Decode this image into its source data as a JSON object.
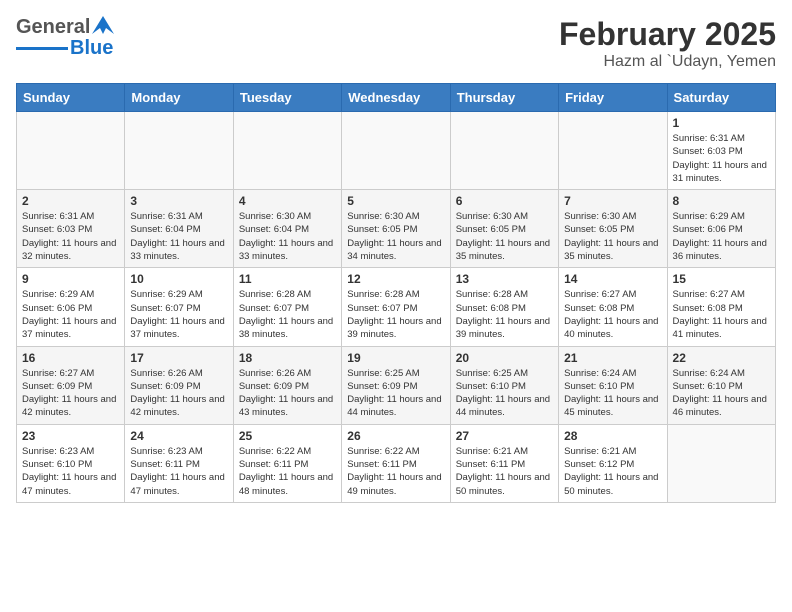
{
  "header": {
    "logo_general": "General",
    "logo_blue": "Blue",
    "title": "February 2025",
    "subtitle": "Hazm al `Udayn, Yemen"
  },
  "calendar": {
    "headers": [
      "Sunday",
      "Monday",
      "Tuesday",
      "Wednesday",
      "Thursday",
      "Friday",
      "Saturday"
    ],
    "weeks": [
      [
        {
          "day": "",
          "info": ""
        },
        {
          "day": "",
          "info": ""
        },
        {
          "day": "",
          "info": ""
        },
        {
          "day": "",
          "info": ""
        },
        {
          "day": "",
          "info": ""
        },
        {
          "day": "",
          "info": ""
        },
        {
          "day": "1",
          "info": "Sunrise: 6:31 AM\nSunset: 6:03 PM\nDaylight: 11 hours and 31 minutes."
        }
      ],
      [
        {
          "day": "2",
          "info": "Sunrise: 6:31 AM\nSunset: 6:03 PM\nDaylight: 11 hours and 32 minutes."
        },
        {
          "day": "3",
          "info": "Sunrise: 6:31 AM\nSunset: 6:04 PM\nDaylight: 11 hours and 33 minutes."
        },
        {
          "day": "4",
          "info": "Sunrise: 6:30 AM\nSunset: 6:04 PM\nDaylight: 11 hours and 33 minutes."
        },
        {
          "day": "5",
          "info": "Sunrise: 6:30 AM\nSunset: 6:05 PM\nDaylight: 11 hours and 34 minutes."
        },
        {
          "day": "6",
          "info": "Sunrise: 6:30 AM\nSunset: 6:05 PM\nDaylight: 11 hours and 35 minutes."
        },
        {
          "day": "7",
          "info": "Sunrise: 6:30 AM\nSunset: 6:05 PM\nDaylight: 11 hours and 35 minutes."
        },
        {
          "day": "8",
          "info": "Sunrise: 6:29 AM\nSunset: 6:06 PM\nDaylight: 11 hours and 36 minutes."
        }
      ],
      [
        {
          "day": "9",
          "info": "Sunrise: 6:29 AM\nSunset: 6:06 PM\nDaylight: 11 hours and 37 minutes."
        },
        {
          "day": "10",
          "info": "Sunrise: 6:29 AM\nSunset: 6:07 PM\nDaylight: 11 hours and 37 minutes."
        },
        {
          "day": "11",
          "info": "Sunrise: 6:28 AM\nSunset: 6:07 PM\nDaylight: 11 hours and 38 minutes."
        },
        {
          "day": "12",
          "info": "Sunrise: 6:28 AM\nSunset: 6:07 PM\nDaylight: 11 hours and 39 minutes."
        },
        {
          "day": "13",
          "info": "Sunrise: 6:28 AM\nSunset: 6:08 PM\nDaylight: 11 hours and 39 minutes."
        },
        {
          "day": "14",
          "info": "Sunrise: 6:27 AM\nSunset: 6:08 PM\nDaylight: 11 hours and 40 minutes."
        },
        {
          "day": "15",
          "info": "Sunrise: 6:27 AM\nSunset: 6:08 PM\nDaylight: 11 hours and 41 minutes."
        }
      ],
      [
        {
          "day": "16",
          "info": "Sunrise: 6:27 AM\nSunset: 6:09 PM\nDaylight: 11 hours and 42 minutes."
        },
        {
          "day": "17",
          "info": "Sunrise: 6:26 AM\nSunset: 6:09 PM\nDaylight: 11 hours and 42 minutes."
        },
        {
          "day": "18",
          "info": "Sunrise: 6:26 AM\nSunset: 6:09 PM\nDaylight: 11 hours and 43 minutes."
        },
        {
          "day": "19",
          "info": "Sunrise: 6:25 AM\nSunset: 6:09 PM\nDaylight: 11 hours and 44 minutes."
        },
        {
          "day": "20",
          "info": "Sunrise: 6:25 AM\nSunset: 6:10 PM\nDaylight: 11 hours and 44 minutes."
        },
        {
          "day": "21",
          "info": "Sunrise: 6:24 AM\nSunset: 6:10 PM\nDaylight: 11 hours and 45 minutes."
        },
        {
          "day": "22",
          "info": "Sunrise: 6:24 AM\nSunset: 6:10 PM\nDaylight: 11 hours and 46 minutes."
        }
      ],
      [
        {
          "day": "23",
          "info": "Sunrise: 6:23 AM\nSunset: 6:10 PM\nDaylight: 11 hours and 47 minutes."
        },
        {
          "day": "24",
          "info": "Sunrise: 6:23 AM\nSunset: 6:11 PM\nDaylight: 11 hours and 47 minutes."
        },
        {
          "day": "25",
          "info": "Sunrise: 6:22 AM\nSunset: 6:11 PM\nDaylight: 11 hours and 48 minutes."
        },
        {
          "day": "26",
          "info": "Sunrise: 6:22 AM\nSunset: 6:11 PM\nDaylight: 11 hours and 49 minutes."
        },
        {
          "day": "27",
          "info": "Sunrise: 6:21 AM\nSunset: 6:11 PM\nDaylight: 11 hours and 50 minutes."
        },
        {
          "day": "28",
          "info": "Sunrise: 6:21 AM\nSunset: 6:12 PM\nDaylight: 11 hours and 50 minutes."
        },
        {
          "day": "",
          "info": ""
        }
      ]
    ]
  }
}
